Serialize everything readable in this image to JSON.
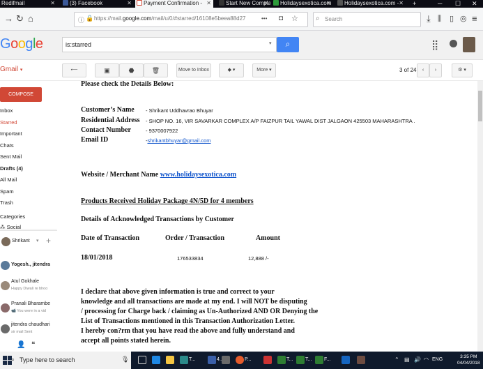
{
  "browser": {
    "tabs": [
      {
        "label": "Redifmail"
      },
      {
        "label": "(3) Facebook"
      },
      {
        "label": "Payment Confirmation -"
      },
      {
        "label": "Start New Complaint - H"
      },
      {
        "label": "Holidaysexotica.com -"
      },
      {
        "label": "Holidaysexotica.com -"
      }
    ],
    "url_prefix": "https://mail.",
    "url_domain": "google.com",
    "url_rest": "/mail/u/0/#starred/16108e5beea88d27",
    "url_more": "•••",
    "search_placeholder": "Search"
  },
  "gmail": {
    "logo": "Google",
    "search_value": "is:starred",
    "label": "Gmail",
    "compose": "COMPOSE",
    "nav": [
      "Inbox",
      "Starred",
      "Important",
      "Chats",
      "Sent Mail",
      "Drafts (4)",
      "All Mail",
      "Spam",
      "Trash",
      "Categories",
      "Social"
    ],
    "toolbar": {
      "move_to_inbox": "Move to Inbox",
      "more": "More",
      "pager": "3 of 24"
    },
    "hangouts": {
      "self": "Shrikant",
      "contacts": [
        {
          "name": "Yogesh., jitendra",
          "preview": ""
        },
        {
          "name": "Atul Gokhale",
          "preview": "Happy Diwali re bhoo"
        },
        {
          "name": "Pranali Bharambe",
          "preview": "You were in a vid"
        },
        {
          "name": "jitendra chaudhari",
          "preview": "sir mail Sent"
        }
      ]
    }
  },
  "email": {
    "intro": "Please check the Details Below:",
    "fields": [
      {
        "label": "Customer’s Name",
        "value": "- Shrikant Uddhavrao Bhuyar"
      },
      {
        "label": "Residential Address",
        "value": "- SHOP NO. 16, VIR SAVARKAR COMPLEX A/P FAIZPUR TAIL YAWAL DIST JALGAON 425503 MAHARASHTRA ."
      },
      {
        "label": "Contact Number",
        "value": "- 9370007922"
      },
      {
        "label": "Email ID",
        "value": "shrikantbhuyar@gmail.com"
      }
    ],
    "email_dash": "-",
    "merchant_label": "Website / Merchant Name ",
    "merchant_link": "www.holidaysexotica.com",
    "products": "Products Received Holiday Package 4N/5D for 4 members",
    "ack_title": "Details of Acknowledged Transactions by Customer",
    "table": {
      "headers": [
        "Date of Transaction",
        "Order / Transaction",
        "Amount"
      ],
      "row": [
        "18/01/2018",
        "176533834",
        "12,888 /-"
      ]
    },
    "declaration": [
      "I declare that above given information is true and correct to your",
      "knowledge and all transactions are made at my end. I will NOT be disputing",
      "/ processing for Charge back / claiming as Un-Authorized AND OR Denying the",
      "List of Transactions mentioned in this Transaction Authorization Letter.",
      "I hereby con?rm that you have read the above and fully understand and",
      "accept all points stated herein."
    ]
  },
  "taskbar": {
    "search_placeholder": "Type here to search",
    "app_labels": [
      "T...",
      "4...",
      "P...",
      "T...",
      "T...",
      "F..."
    ],
    "lang": "ENG",
    "time": "3:35 PM",
    "date": "04/04/2018"
  }
}
